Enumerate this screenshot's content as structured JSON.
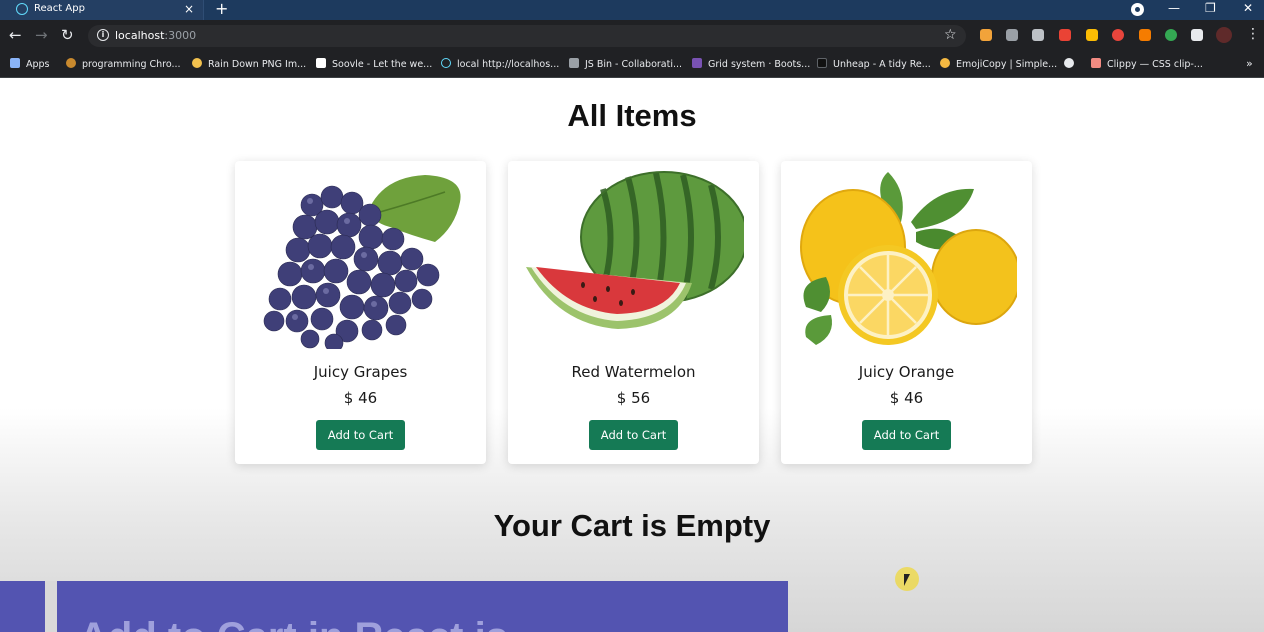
{
  "browser": {
    "tab_title": "React App",
    "tab_close": "×",
    "new_tab": "+",
    "url_host": "localhost",
    "url_port": ":3000",
    "window_minimize": "—",
    "window_restore": "❐",
    "window_close": "✕",
    "bookmarks": [
      {
        "label": "Apps",
        "color": "#8ab4f8"
      },
      {
        "label": "programming Chro...",
        "color": "#c98a2e"
      },
      {
        "label": "Rain Down PNG Im...",
        "color": "#f2c14e"
      },
      {
        "label": "Soovle - Let the we...",
        "color": "#ffffff"
      },
      {
        "label": "local http://localhos...",
        "color": "#61dafb"
      },
      {
        "label": "JS Bin - Collaborati...",
        "color": "#9aa0a6"
      },
      {
        "label": "Grid system · Boots...",
        "color": "#7952b3"
      },
      {
        "label": "Unheap - A tidy Re...",
        "color": "#111111"
      },
      {
        "label": "EmojiCopy | Simple...",
        "color": "#f5b942"
      },
      {
        "label": "",
        "color": "#e8eaed"
      },
      {
        "label": "Clippy — CSS clip-...",
        "color": "#f28b82"
      }
    ],
    "bookmarks_more": "»"
  },
  "page": {
    "heading": "All Items",
    "cart_heading": "Your Cart is Empty",
    "products": [
      {
        "name": "Juicy Grapes",
        "price": "$ 46",
        "button": "Add to Cart",
        "image": "grapes"
      },
      {
        "name": "Red Watermelon",
        "price": "$ 56",
        "button": "Add to Cart",
        "image": "watermelon"
      },
      {
        "name": "Juicy Orange",
        "price": "$ 46",
        "button": "Add to Cart",
        "image": "lemons"
      }
    ],
    "banner_text": "Add to Cart in React js"
  },
  "colors": {
    "tab_bar": "#1d3a5e",
    "toolbar": "#202124",
    "button": "#157a55",
    "banner": "#5354b1"
  }
}
